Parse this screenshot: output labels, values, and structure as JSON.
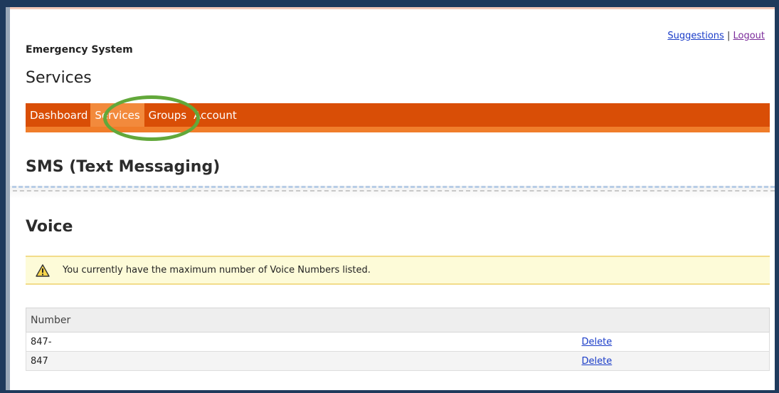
{
  "header": {
    "suggestions_link": "Suggestions",
    "separator": "|",
    "logout_link": "Logout",
    "system_name": "Emergency System",
    "page_title": "Services"
  },
  "nav": {
    "items": [
      {
        "label": "Dashboard",
        "active": false
      },
      {
        "label": "Services",
        "active": true
      },
      {
        "label": "Groups",
        "active": false
      },
      {
        "label": "Account",
        "active": false
      }
    ]
  },
  "sections": {
    "sms_title": "SMS (Text Messaging)",
    "voice_title": "Voice"
  },
  "warning": {
    "icon": "warning-icon",
    "message": "You currently have the maximum number of Voice Numbers listed."
  },
  "voice_table": {
    "headers": [
      "Number",
      ""
    ],
    "rows": [
      {
        "number": "847-",
        "action": "Delete"
      },
      {
        "number": "847",
        "action": "Delete"
      }
    ]
  },
  "colors": {
    "nav_bg": "#d94e06",
    "nav_active": "#f28a3c",
    "highlight_circle": "#62a83a",
    "link": "#1a3cc8"
  }
}
